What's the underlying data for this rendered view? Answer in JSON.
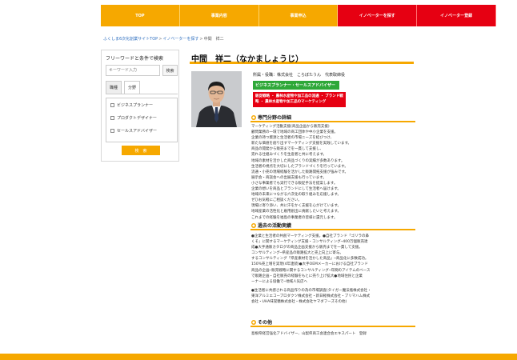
{
  "nav": {
    "items": [
      {
        "label": "TOP"
      },
      {
        "label": "事業内容"
      },
      {
        "label": "事業申込"
      },
      {
        "label": "イノベーターを探す"
      },
      {
        "label": "イノベーター登録"
      }
    ]
  },
  "breadcrumb": {
    "home": "ふくしま6次化創業サイトTOP",
    "list": "イノベーターを探す",
    "current": "中間　祥二"
  },
  "sidebar": {
    "title": "フリーワードと条件で検索",
    "search_placeholder": "キーワード入力",
    "search_button": "検索",
    "tabs": [
      {
        "label": "職種"
      },
      {
        "label": "分野"
      }
    ],
    "filters": [
      {
        "label": "ビジネスプランナー"
      },
      {
        "label": "プロダクトデザイナー"
      },
      {
        "label": "セールスアドバイザー"
      }
    ],
    "submit": "検　索"
  },
  "profile": {
    "name": "中間　祥二（なかましょうじ）",
    "affiliation": "所属・役職：株式会社　こらぼたうん　代表取締役",
    "badge_green": "ビジネスプランナー・セールスアドバイザー",
    "badge_red": "販促戦略 ・ 農林水産物や加工品の流通 ・ ブランド戦略 ・ 農林水産物や加工品のマーケティング"
  },
  "sections": {
    "specialty": {
      "title": "専門分野の詳細",
      "lines": [
        "マーケティング活動支援(商品企画から販売支援)",
        "顧問業務の一環で地域の商工団体や中小企業を支援。",
        "企業の持つ資源と生活者の市場ニーズを結びつけ、",
        "新たな価値を創り出すマーケティング支援を実践しています。",
        "商品の開発から販売までを一貫して支援し、",
        "売れる仕組みづくりを生産者と共に考えます。",
        "地域の素材を活かした商品づくりの実績が多数あります。",
        "生活者の視点を大切にしたブランドづくりを行っています。",
        "流通・小売の現場経験を活かした販路開拓支援が強みです。",
        "展示会・商談会への出展支援も行っています。",
        "小さな事業者でも実行できる販促手法を提案します。",
        "企業の想いを商品とブランドにして生活者へ届けます。",
        "地域の未来につながる六次化の取り組みを応援します。",
        "ぜひお気軽にご相談ください。",
        "現場に寄り添い、共に汗をかく支援を心がけています。",
        "地域産業の活性化と雇用創出に貢献したいと考えます。",
        "これまでの経験を福島の事業者の皆様に還元します。"
      ]
    },
    "achievements": {
      "title": "過去の活動実績",
      "lines": [
        "●企業と生活者の共創マーケティング支援。●自社ブランド「ゴリラの鼻",
        "くそ」に関するマーケティング支援・コンサルティング─400万個販売達",
        "成●大手通販カタログの商品企画支援から販売までを一貫して支援。",
        "コンサルティング─県産品の販路拡大と売上向上に寄与。",
        "するコンサルティング「県産素材を活かした商品」─商品化に多数成功。",
        "150%売上増を実現(4年連続)●大手OEMメーカーにおける自社ブランド",
        "商品の企画─販売戦略に関するコンサルティング─年間のアイテムのベース",
        "で販路企画・自社販売の経験をもとに売り上げ拡大●地域住民と企業",
        "ーナーによる協働で─地域人気店へ",
        "●生活者に共感される商品作りの為の市場調査(タイガー魔法瓶株式会社・",
        "東洋アルミエコープロダクツ株式会社・新日軽株式会社・プリマハム株式",
        "会社・UHA味覚糖株式会社・株式会社ヤマダフーズその他)"
      ]
    },
    "other": {
      "title": "その他",
      "text": "島根県経営強化アドバイザー、山梨県商工会連合会エキスパート　登録"
    }
  }
}
